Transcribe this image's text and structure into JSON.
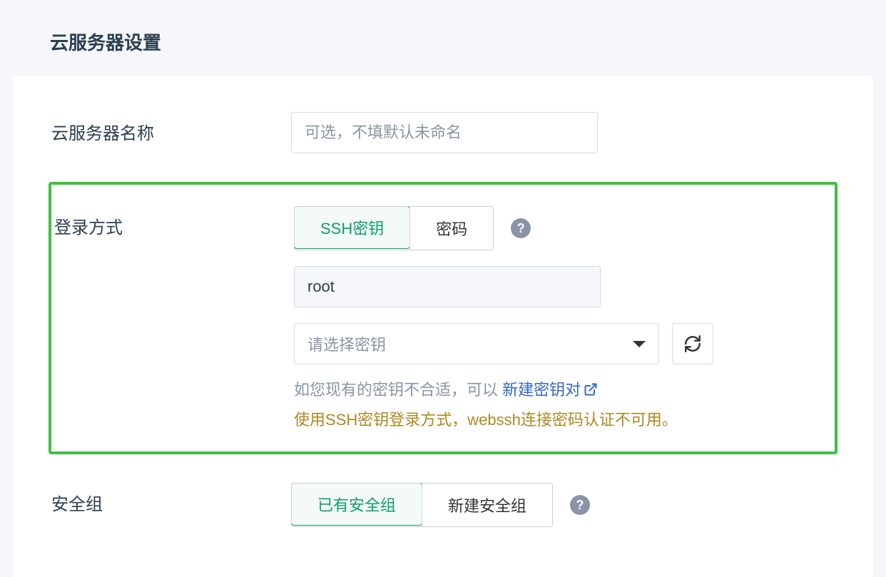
{
  "header": {
    "title": "云服务器设置"
  },
  "serverName": {
    "label": "云服务器名称",
    "placeholder": "可选，不填默认未命名"
  },
  "loginMethod": {
    "label": "登录方式",
    "option_ssh": "SSH密钥",
    "option_password": "密码",
    "username": "root",
    "key_select_placeholder": "请选择密钥",
    "hint_prefix": "如您现有的密钥不合适，可以 ",
    "hint_link": "新建密钥对",
    "warning": "使用SSH密钥登录方式，webssh连接密码认证不可用。"
  },
  "securityGroup": {
    "label": "安全组",
    "option_existing": "已有安全组",
    "option_new": "新建安全组"
  }
}
